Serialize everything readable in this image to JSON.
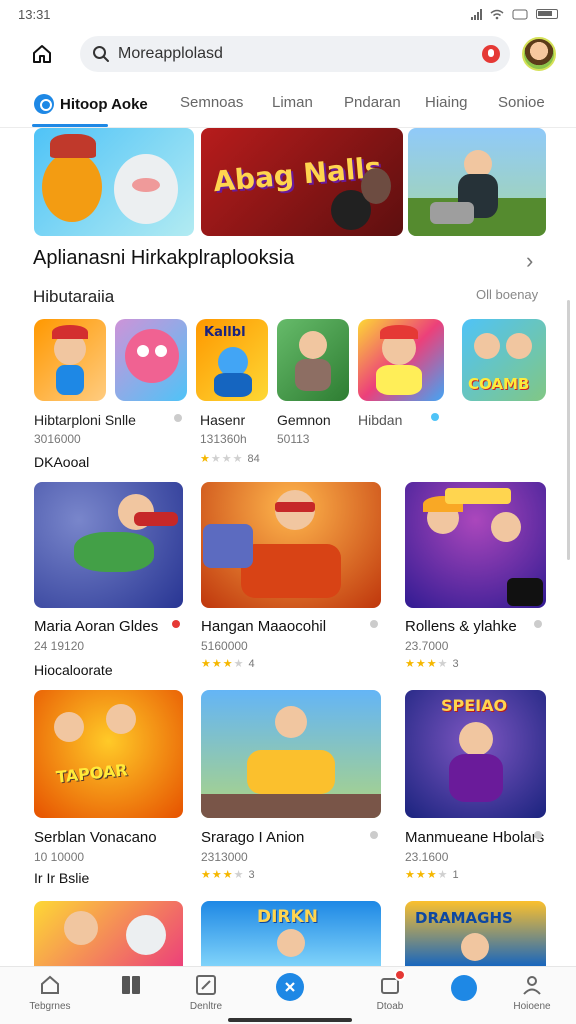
{
  "status": {
    "time": "13:31"
  },
  "search": {
    "placeholder": "Moreapplolasd"
  },
  "tabs": [
    {
      "label": "Hitoop Aoke"
    },
    {
      "label": "Semnoas"
    },
    {
      "label": "Liman"
    },
    {
      "label": "Pndaran"
    },
    {
      "label": "Hiaing"
    },
    {
      "label": "Sonioe"
    }
  ],
  "banner": {
    "center_text": "Abag Nalls"
  },
  "section": {
    "title": "Aplianasni Hirkakplraplooksia",
    "sub_title": "Hibutaraiia",
    "sub_action": "Oll boenay"
  },
  "small_apps": [
    {
      "name": "Hibtarploni Snlle",
      "meta": "3016000",
      "extra": "DKAooal",
      "art_text": ""
    },
    {
      "name": "Hasenr",
      "meta": "131360h",
      "stars": 1,
      "rating": "84",
      "art_text": ""
    },
    {
      "name": "Gemnon",
      "meta": "50113",
      "art_text": "Kallbl"
    },
    {
      "name": "Hibdan",
      "meta": "",
      "art_text": ""
    },
    {
      "name": "",
      "meta": "",
      "art_text": "COAMB"
    }
  ],
  "big_apps": [
    {
      "name": "Maria Aoran Gldes",
      "meta": "24 19120",
      "extra": "Hiocaloorate"
    },
    {
      "name": "Hangan Maaocohil",
      "meta": "5160000",
      "stars": 3,
      "rating": "4"
    },
    {
      "name": "Rollens & ylahke",
      "meta": "23.7000",
      "stars": 3,
      "rating": "3"
    },
    {
      "name": "Serblan Vonacano",
      "meta": "10 10000",
      "extra": "Ir Ir Bslie",
      "art_text": "TAPOAR"
    },
    {
      "name": "Srarago I Anion",
      "meta": "2313000",
      "stars": 3,
      "rating": "3"
    },
    {
      "name": "Manmueane Hbolars",
      "meta": "23.1600",
      "stars": 3,
      "rating": "1",
      "art_text": "SPEIAO"
    }
  ],
  "bottom_row": [
    {
      "art_text": ""
    },
    {
      "art_text": "DIRKN"
    },
    {
      "art_text": "DRAMAGHS"
    }
  ],
  "bottom_nav": [
    {
      "label": "Tebgrnes"
    },
    {
      "label": ""
    },
    {
      "label": "Denltre"
    },
    {
      "label": ""
    },
    {
      "label": "Dtoab"
    },
    {
      "label": ""
    },
    {
      "label": "Hoioene"
    }
  ],
  "colors": {
    "accent": "#1e88e5",
    "star": "#f5b700",
    "badge": "#e53935"
  }
}
